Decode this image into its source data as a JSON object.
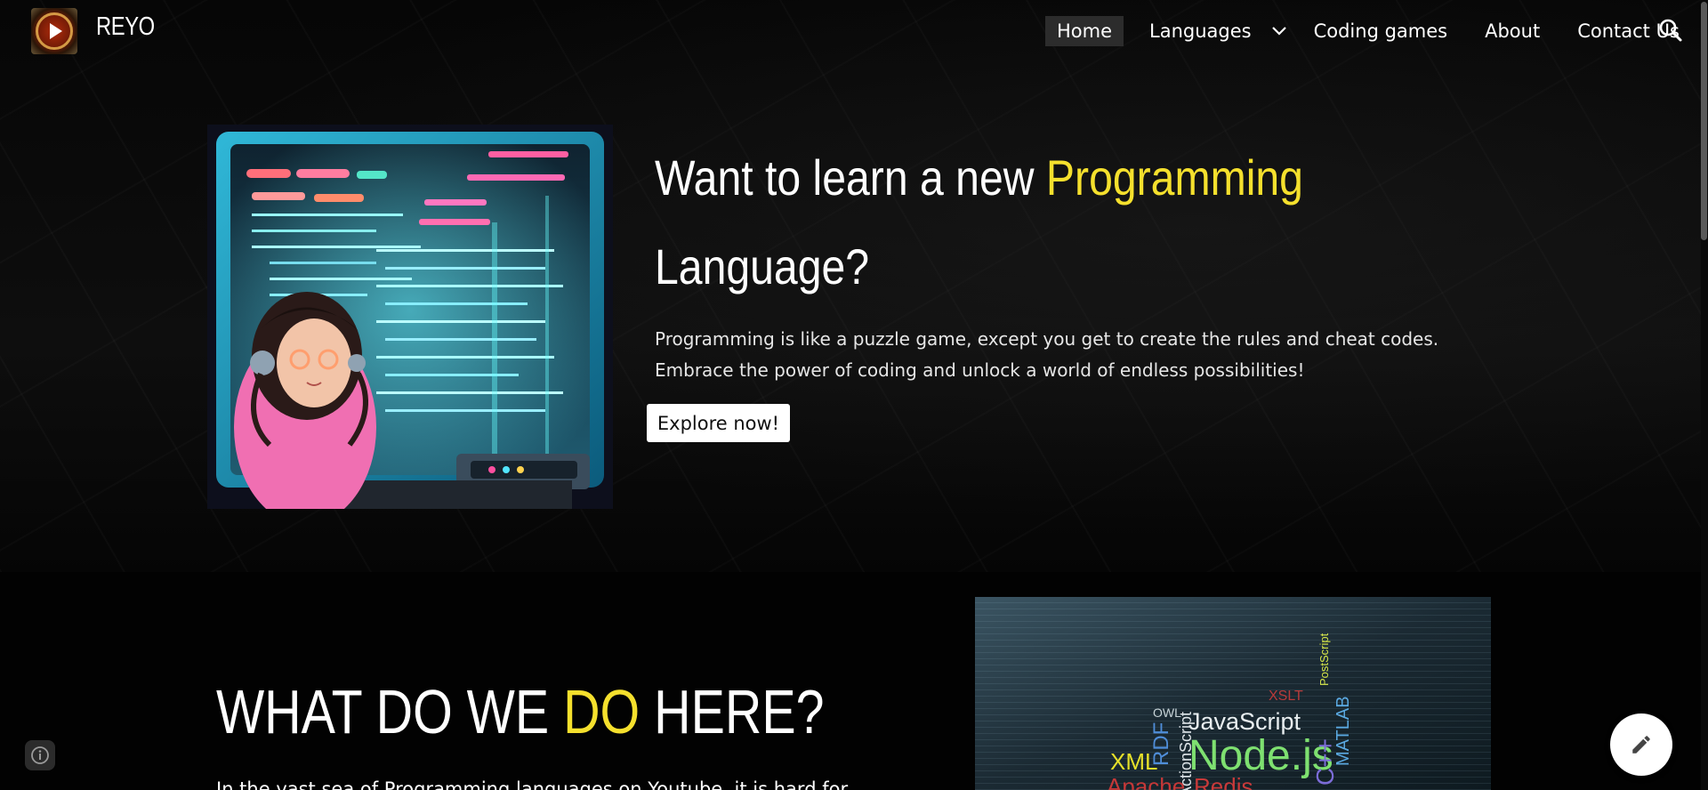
{
  "site": {
    "title": "REYO"
  },
  "nav": {
    "items": [
      {
        "label": "Home",
        "active": true
      },
      {
        "label": "Languages",
        "has_dropdown": true
      },
      {
        "label": "Coding games"
      },
      {
        "label": "About"
      },
      {
        "label": "Contact Us"
      }
    ]
  },
  "icons": {
    "search": "search-icon",
    "dropdown": "chevron-down-icon",
    "info": "info-icon",
    "edit": "pencil-icon"
  },
  "hero": {
    "heading_part1": "Want to learn a new ",
    "heading_highlight": "Programming",
    "heading_part2": "Language?",
    "paragraph": "Programming is like a puzzle game, except you get to create the rules and cheat codes. Embrace the power of coding and unlock a world of endless possibilities!",
    "button_label": "Explore now!"
  },
  "section2": {
    "heading_part1": "WHAT DO WE ",
    "heading_highlight": "DO",
    "heading_part2": " HERE?",
    "intro": "In the vast sea of Programming languages on Youtube, it is hard for"
  },
  "collage": {
    "words": [
      "OWL",
      "JavaScript",
      "PostScript",
      "RDF",
      "XML",
      "Node.js",
      "C++",
      "MATLAB",
      "ActionScript",
      "Redis",
      "Apache",
      "XSLT"
    ]
  },
  "colors": {
    "accent": "#f5e02d",
    "background": "#020202",
    "nav_active_bg": "#2c2c2c",
    "button_bg": "#ffffff"
  }
}
